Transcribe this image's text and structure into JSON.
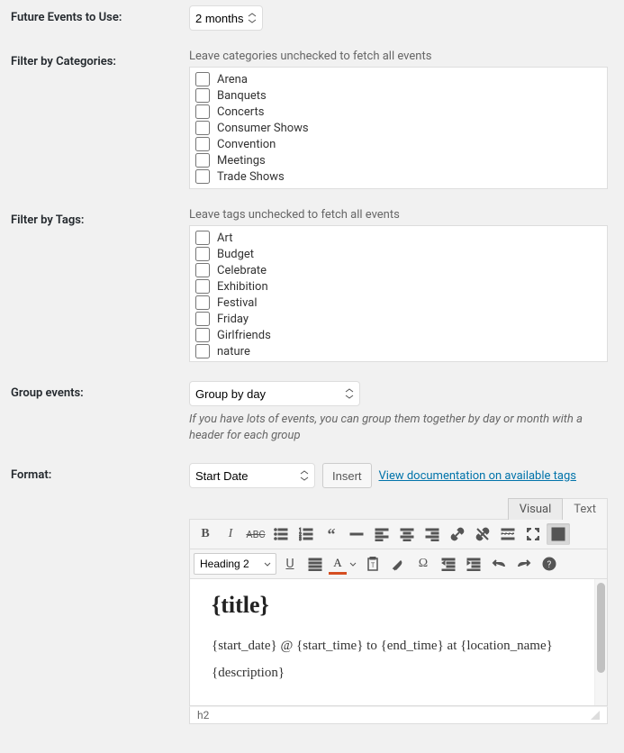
{
  "future_events": {
    "label": "Future Events to Use:",
    "value": "2 months",
    "options": [
      "2 months"
    ]
  },
  "categories": {
    "label": "Filter by Categories:",
    "help": "Leave categories unchecked to fetch all events",
    "items": [
      "Arena",
      "Banquets",
      "Concerts",
      "Consumer Shows",
      "Convention",
      "Meetings",
      "Trade Shows"
    ]
  },
  "tags": {
    "label": "Filter by Tags:",
    "help": "Leave tags unchecked to fetch all events",
    "items": [
      "Art",
      "Budget",
      "Celebrate",
      "Exhibition",
      "Festival",
      "Friday",
      "Girlfriends",
      "nature"
    ]
  },
  "group": {
    "label": "Group events:",
    "value": "Group by day",
    "options": [
      "Group by day"
    ],
    "help": "If you have lots of events, you can group them together by day or month with a header for each group"
  },
  "format": {
    "label": "Format:",
    "select_value": "Start Date",
    "select_options": [
      "Start Date"
    ],
    "insert_label": "Insert",
    "doc_link_text": "View documentation on available tags",
    "tabs": {
      "visual": "Visual",
      "text": "Text"
    },
    "heading_select": "Heading 2",
    "heading_options": [
      "Heading 2"
    ],
    "content_title": "{title}",
    "content_line1": "{start_date} @ {start_time} to {end_time} at {location_name}",
    "content_line2": "{description}",
    "status_path": "h2"
  }
}
